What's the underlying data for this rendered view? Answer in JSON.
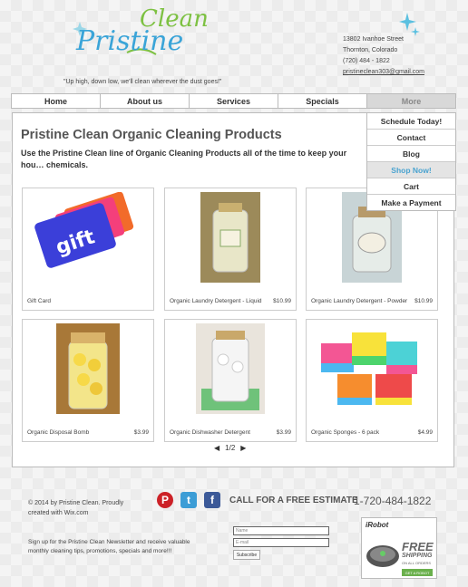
{
  "brand": {
    "name_main": "Pristine",
    "name_accent": "Clean",
    "tagline": "\"Up high, down low, we'll clean wherever the dust goes!\""
  },
  "contact": {
    "street": "13802 Ivanhoe Street",
    "city": "Thornton, Colorado",
    "phone": "(720) 484 - 1822",
    "email": "pristineclean303@gmail.com"
  },
  "nav": {
    "items": [
      "Home",
      "About us",
      "Services",
      "Specials",
      "More"
    ]
  },
  "dropdown": {
    "items": [
      "Schedule Today!",
      "Contact",
      "Blog",
      "Shop Now!",
      "Cart",
      "Make a Payment"
    ],
    "active": "Shop Now!"
  },
  "page": {
    "title": "Pristine Clean Organic Cleaning Products",
    "subtitle": "Use the Pristine Clean line of Organic Cleaning Products all of the time to keep your hou… chemicals."
  },
  "products": [
    {
      "name": "Gift Card",
      "price": "",
      "image": "gift-card"
    },
    {
      "name": "Organic Laundry Detergent - Liquid",
      "price": "$10.99",
      "image": "liquid-detergent-jar"
    },
    {
      "name": "Organic Laundry Detergent - Powder",
      "price": "$10.99",
      "image": "powder-detergent-jar"
    },
    {
      "name": "Organic Disposal Bomb",
      "price": "$3.99",
      "image": "disposal-bomb-jar"
    },
    {
      "name": "Organic Dishwasher Detergent",
      "price": "$3.99",
      "image": "dishwasher-detergent-jar"
    },
    {
      "name": "Organic Sponges - 6 pack",
      "price": "$4.99",
      "image": "sponges"
    }
  ],
  "pager": {
    "prev": "◀",
    "label": "1/2",
    "next": "▶"
  },
  "footer": {
    "copyright": "© 2014 by Pristine Clean. Proudly created with Wix.com",
    "newsletter": "Sign up for the Pristine Clean Newsletter and receive valuable monthly cleaning tips, promotions, specials and more!!!",
    "cta": "CALL FOR A FREE ESTIMATE",
    "phone": "1-720-484-1822",
    "name_placeholder": "Name",
    "email_placeholder": "E-mail",
    "subscribe_label": "Subscribe",
    "ad": {
      "brand": "iRobot",
      "line1": "FREE",
      "line2": "SHIPPING",
      "line3": "ON ALL ORDERS",
      "button": "GET A ROBOT"
    }
  },
  "social": {
    "pinterest": "pinterest-icon",
    "twitter": "twitter-icon",
    "facebook": "facebook-icon",
    "colors": {
      "pinterest": "#cc2127",
      "twitter": "#3c9dd6",
      "facebook": "#3b5998"
    }
  }
}
